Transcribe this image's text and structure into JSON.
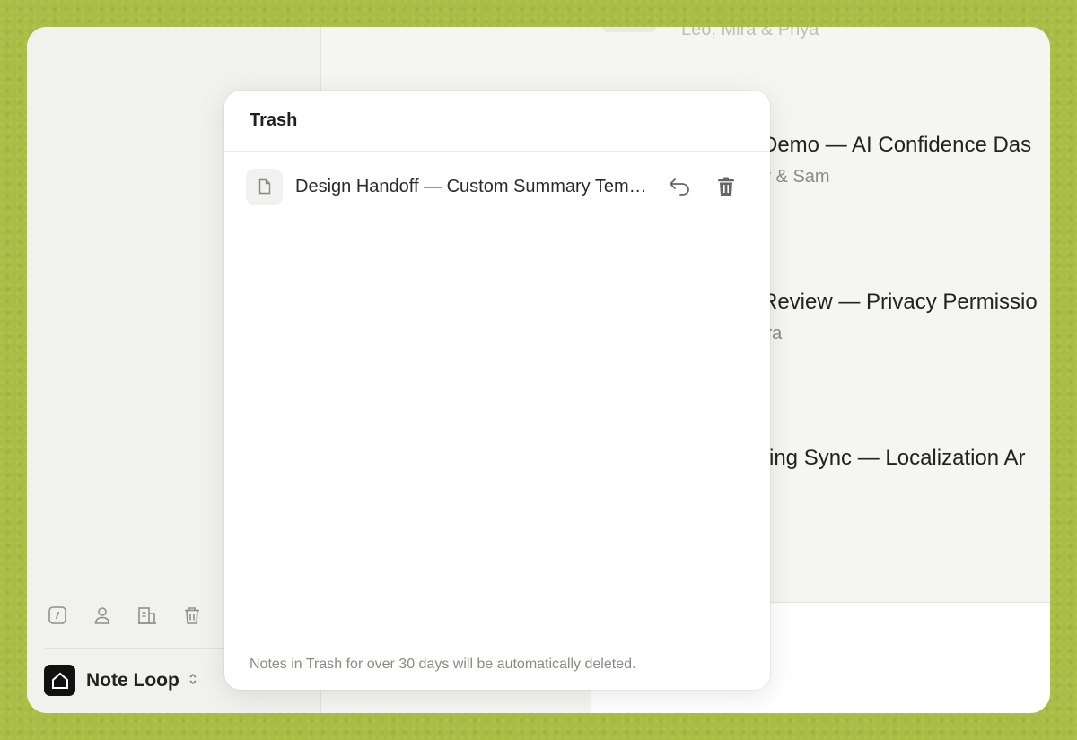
{
  "sidebar": {
    "tools": [
      {
        "icon": "compose-icon"
      },
      {
        "icon": "person-icon"
      },
      {
        "icon": "building-icon"
      },
      {
        "icon": "trash-icon"
      }
    ],
    "workspace": {
      "name": "Note Loop",
      "chevron": "⌃⌄"
    }
  },
  "main": {
    "top_partial_text": "Leo, Mira & Priya",
    "notes": [
      {
        "title": "Demo — AI Confidence Das",
        "subtitle": "y & Sam"
      },
      {
        "title": "Review — Privacy Permissio",
        "subtitle": "ira"
      },
      {
        "title": "ring Sync — Localization Ar",
        "subtitle": ""
      }
    ]
  },
  "trash_modal": {
    "title": "Trash",
    "items": [
      {
        "title": "Design Handoff — Custom Summary Templates"
      }
    ],
    "footer": "Notes in Trash for over 30 days will be automatically deleted."
  }
}
